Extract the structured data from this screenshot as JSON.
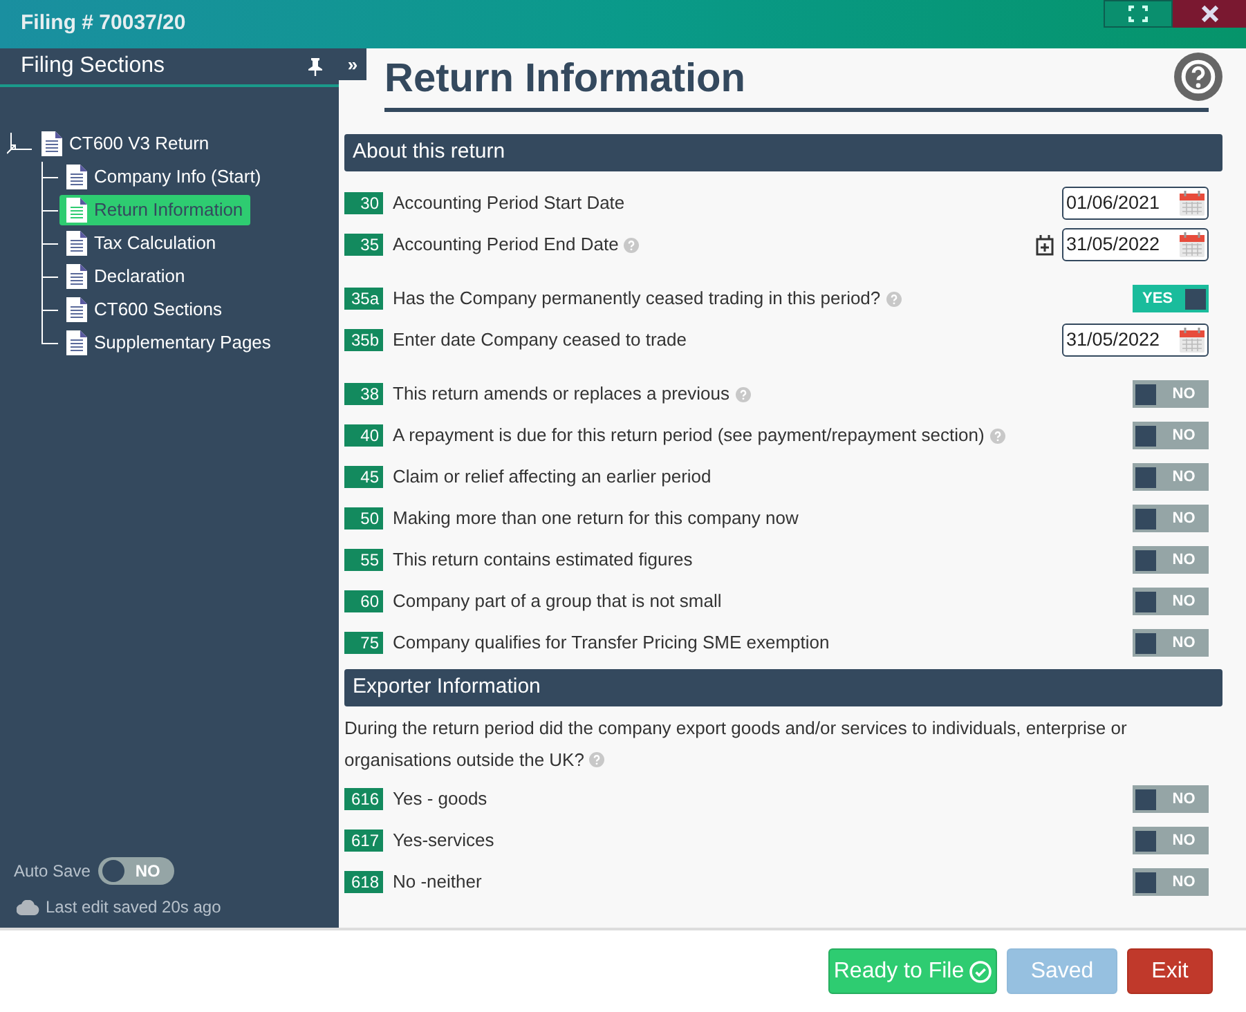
{
  "window": {
    "title": "Filing # 70037/20"
  },
  "sidebar": {
    "title": "Filing Sections",
    "collapse": "»",
    "tree": {
      "label": "CT600 V3 Return",
      "selected": false,
      "children": [
        {
          "label": "Company Info (Start)",
          "selected": false
        },
        {
          "label": "Return Information",
          "selected": true
        },
        {
          "label": "Tax Calculation",
          "selected": false
        },
        {
          "label": "Declaration",
          "selected": false
        },
        {
          "label": "CT600 Sections",
          "selected": false
        },
        {
          "label": "Supplementary Pages",
          "selected": false
        }
      ]
    },
    "auto_save": {
      "label": "Auto Save",
      "on": false,
      "text": "NO"
    },
    "last_saved": "Last edit saved 20s ago"
  },
  "page": {
    "title": "Return Information"
  },
  "sections": [
    {
      "title": "About this return",
      "groups": [
        [
          {
            "code": "30",
            "label": "Accounting Period Start Date",
            "help": false,
            "kind": "date",
            "value": "01/06/2021",
            "add_date": false
          },
          {
            "code": "35",
            "label": "Accounting Period End Date",
            "help": true,
            "kind": "date",
            "value": "31/05/2022",
            "add_date": true
          }
        ],
        [
          {
            "code": "35a",
            "label": "Has the Company permanently ceased trading in this period?",
            "help": true,
            "kind": "toggle",
            "on": true,
            "text": "YES"
          },
          {
            "code": "35b",
            "label": "Enter date Company ceased to trade",
            "help": false,
            "kind": "date",
            "value": "31/05/2022",
            "add_date": false
          }
        ],
        [
          {
            "code": "38",
            "label": "This return amends or replaces a previous",
            "help": true,
            "kind": "toggle",
            "on": false,
            "text": "NO"
          },
          {
            "code": "40",
            "label": "A repayment is due for this return period (see payment/repayment section)",
            "help": true,
            "kind": "toggle",
            "on": false,
            "text": "NO"
          },
          {
            "code": "45",
            "label": "Claim or relief affecting an earlier period",
            "help": false,
            "kind": "toggle",
            "on": false,
            "text": "NO"
          },
          {
            "code": "50",
            "label": "Making more than one return for this company now",
            "help": false,
            "kind": "toggle",
            "on": false,
            "text": "NO"
          },
          {
            "code": "55",
            "label": "This return contains estimated figures",
            "help": false,
            "kind": "toggle",
            "on": false,
            "text": "NO"
          },
          {
            "code": "60",
            "label": "Company part of a group that is not small",
            "help": false,
            "kind": "toggle",
            "on": false,
            "text": "NO"
          },
          {
            "code": "75",
            "label": "Company qualifies for Transfer Pricing SME exemption",
            "help": false,
            "kind": "toggle",
            "on": false,
            "text": "NO"
          }
        ]
      ]
    },
    {
      "title": "Exporter Information",
      "intro": "During the return period did the company export goods and/or services to individuals, enterprise or organisations outside the UK?",
      "intro_help": true,
      "groups": [
        [
          {
            "code": "616",
            "label": "Yes - goods",
            "help": false,
            "kind": "toggle",
            "on": false,
            "text": "NO"
          },
          {
            "code": "617",
            "label": "Yes-services",
            "help": false,
            "kind": "toggle",
            "on": false,
            "text": "NO"
          },
          {
            "code": "618",
            "label": "No -neither",
            "help": false,
            "kind": "toggle",
            "on": false,
            "text": "NO"
          }
        ]
      ]
    }
  ],
  "buttons": [
    {
      "label": "Ready to File",
      "kind": "primary",
      "disabled": false
    },
    {
      "label": "Saved",
      "kind": "secondary",
      "disabled": true
    },
    {
      "label": "Exit",
      "kind": "danger",
      "disabled": false
    }
  ]
}
